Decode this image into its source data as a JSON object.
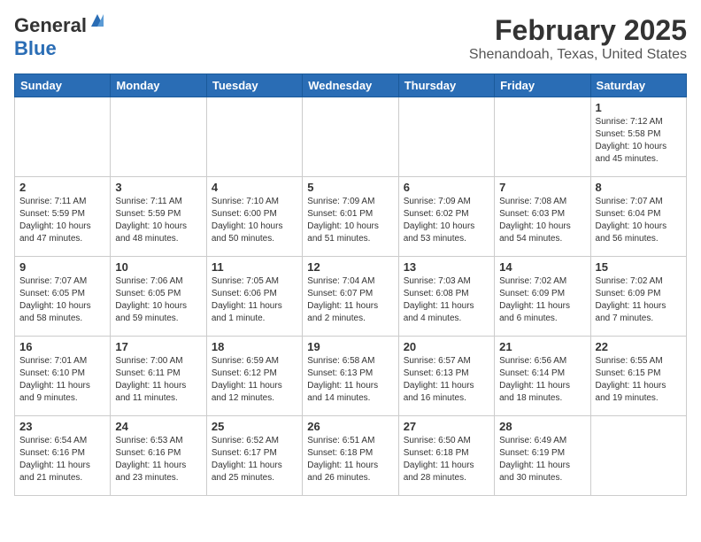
{
  "header": {
    "logo_general": "General",
    "logo_blue": "Blue",
    "title": "February 2025",
    "subtitle": "Shenandoah, Texas, United States"
  },
  "days_of_week": [
    "Sunday",
    "Monday",
    "Tuesday",
    "Wednesday",
    "Thursday",
    "Friday",
    "Saturday"
  ],
  "weeks": [
    [
      {
        "day": "",
        "info": ""
      },
      {
        "day": "",
        "info": ""
      },
      {
        "day": "",
        "info": ""
      },
      {
        "day": "",
        "info": ""
      },
      {
        "day": "",
        "info": ""
      },
      {
        "day": "",
        "info": ""
      },
      {
        "day": "1",
        "info": "Sunrise: 7:12 AM\nSunset: 5:58 PM\nDaylight: 10 hours\nand 45 minutes."
      }
    ],
    [
      {
        "day": "2",
        "info": "Sunrise: 7:11 AM\nSunset: 5:59 PM\nDaylight: 10 hours\nand 47 minutes."
      },
      {
        "day": "3",
        "info": "Sunrise: 7:11 AM\nSunset: 5:59 PM\nDaylight: 10 hours\nand 48 minutes."
      },
      {
        "day": "4",
        "info": "Sunrise: 7:10 AM\nSunset: 6:00 PM\nDaylight: 10 hours\nand 50 minutes."
      },
      {
        "day": "5",
        "info": "Sunrise: 7:09 AM\nSunset: 6:01 PM\nDaylight: 10 hours\nand 51 minutes."
      },
      {
        "day": "6",
        "info": "Sunrise: 7:09 AM\nSunset: 6:02 PM\nDaylight: 10 hours\nand 53 minutes."
      },
      {
        "day": "7",
        "info": "Sunrise: 7:08 AM\nSunset: 6:03 PM\nDaylight: 10 hours\nand 54 minutes."
      },
      {
        "day": "8",
        "info": "Sunrise: 7:07 AM\nSunset: 6:04 PM\nDaylight: 10 hours\nand 56 minutes."
      }
    ],
    [
      {
        "day": "9",
        "info": "Sunrise: 7:07 AM\nSunset: 6:05 PM\nDaylight: 10 hours\nand 58 minutes."
      },
      {
        "day": "10",
        "info": "Sunrise: 7:06 AM\nSunset: 6:05 PM\nDaylight: 10 hours\nand 59 minutes."
      },
      {
        "day": "11",
        "info": "Sunrise: 7:05 AM\nSunset: 6:06 PM\nDaylight: 11 hours\nand 1 minute."
      },
      {
        "day": "12",
        "info": "Sunrise: 7:04 AM\nSunset: 6:07 PM\nDaylight: 11 hours\nand 2 minutes."
      },
      {
        "day": "13",
        "info": "Sunrise: 7:03 AM\nSunset: 6:08 PM\nDaylight: 11 hours\nand 4 minutes."
      },
      {
        "day": "14",
        "info": "Sunrise: 7:02 AM\nSunset: 6:09 PM\nDaylight: 11 hours\nand 6 minutes."
      },
      {
        "day": "15",
        "info": "Sunrise: 7:02 AM\nSunset: 6:09 PM\nDaylight: 11 hours\nand 7 minutes."
      }
    ],
    [
      {
        "day": "16",
        "info": "Sunrise: 7:01 AM\nSunset: 6:10 PM\nDaylight: 11 hours\nand 9 minutes."
      },
      {
        "day": "17",
        "info": "Sunrise: 7:00 AM\nSunset: 6:11 PM\nDaylight: 11 hours\nand 11 minutes."
      },
      {
        "day": "18",
        "info": "Sunrise: 6:59 AM\nSunset: 6:12 PM\nDaylight: 11 hours\nand 12 minutes."
      },
      {
        "day": "19",
        "info": "Sunrise: 6:58 AM\nSunset: 6:13 PM\nDaylight: 11 hours\nand 14 minutes."
      },
      {
        "day": "20",
        "info": "Sunrise: 6:57 AM\nSunset: 6:13 PM\nDaylight: 11 hours\nand 16 minutes."
      },
      {
        "day": "21",
        "info": "Sunrise: 6:56 AM\nSunset: 6:14 PM\nDaylight: 11 hours\nand 18 minutes."
      },
      {
        "day": "22",
        "info": "Sunrise: 6:55 AM\nSunset: 6:15 PM\nDaylight: 11 hours\nand 19 minutes."
      }
    ],
    [
      {
        "day": "23",
        "info": "Sunrise: 6:54 AM\nSunset: 6:16 PM\nDaylight: 11 hours\nand 21 minutes."
      },
      {
        "day": "24",
        "info": "Sunrise: 6:53 AM\nSunset: 6:16 PM\nDaylight: 11 hours\nand 23 minutes."
      },
      {
        "day": "25",
        "info": "Sunrise: 6:52 AM\nSunset: 6:17 PM\nDaylight: 11 hours\nand 25 minutes."
      },
      {
        "day": "26",
        "info": "Sunrise: 6:51 AM\nSunset: 6:18 PM\nDaylight: 11 hours\nand 26 minutes."
      },
      {
        "day": "27",
        "info": "Sunrise: 6:50 AM\nSunset: 6:18 PM\nDaylight: 11 hours\nand 28 minutes."
      },
      {
        "day": "28",
        "info": "Sunrise: 6:49 AM\nSunset: 6:19 PM\nDaylight: 11 hours\nand 30 minutes."
      },
      {
        "day": "",
        "info": ""
      }
    ]
  ]
}
